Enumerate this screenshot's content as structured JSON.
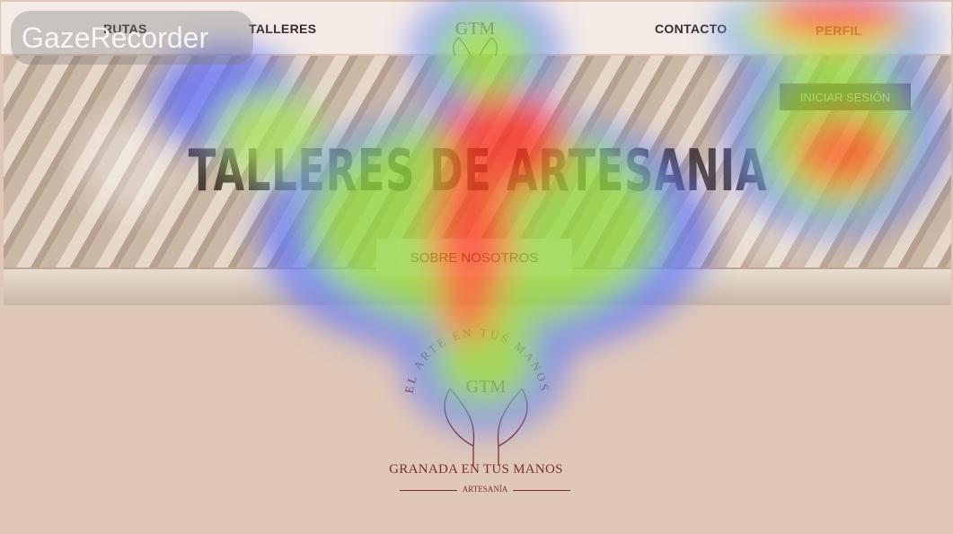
{
  "nav": {
    "items": [
      "RUTAS",
      "TALLERES",
      "CONTACTO",
      "PERFIL"
    ],
    "logo_text": "GTM"
  },
  "hero": {
    "title": "TALLERES DE ARTESANIA",
    "login_label": "INICIAR SESIÓN",
    "about_label": "SOBRE NOSOTROS"
  },
  "brand": {
    "arc_text": "EL ARTE EN TUS MANOS",
    "logo_text": "GTM",
    "name": "GRANADA EN TUS MANOS",
    "subtitle": "ARTESANÍA"
  },
  "watermark": {
    "label": "GazeRecorder"
  },
  "colors": {
    "accent": "#6b2f3a",
    "brand": "#7a2f2a",
    "background": "#e0c8b8"
  }
}
